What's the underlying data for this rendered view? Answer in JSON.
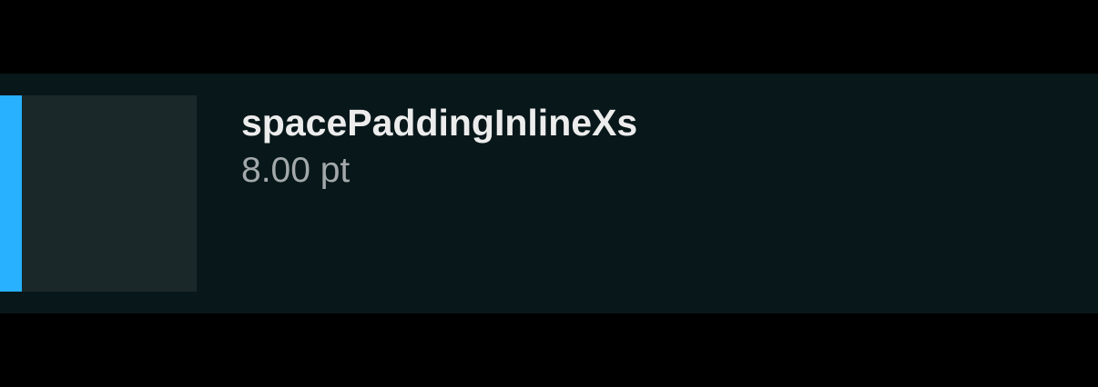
{
  "token": {
    "name": "spacePaddingInlineXs",
    "value": "8.00 pt",
    "accent_color": "#27b1ff"
  }
}
